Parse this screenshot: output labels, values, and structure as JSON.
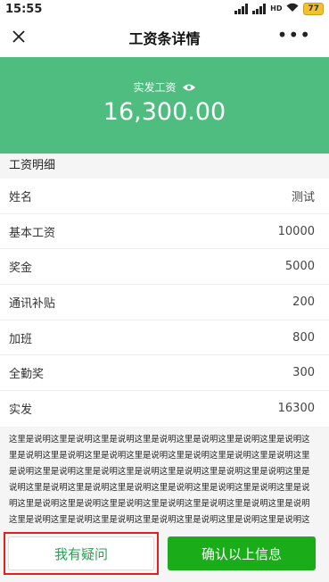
{
  "status_bar": {
    "time": "15:55",
    "network": "HD",
    "battery": "77"
  },
  "titlebar": {
    "title": "工资条详情",
    "more": "•••"
  },
  "banner": {
    "label": "实发工资",
    "amount": "16,300.00"
  },
  "section": {
    "title": "工资明细"
  },
  "rows": [
    {
      "label": "姓名",
      "value": "测试"
    },
    {
      "label": "基本工资",
      "value": "10000"
    },
    {
      "label": "奖金",
      "value": "5000"
    },
    {
      "label": "通讯补贴",
      "value": "200"
    },
    {
      "label": "加班",
      "value": "800"
    },
    {
      "label": "全勤奖",
      "value": "300"
    },
    {
      "label": "实发",
      "value": "16300"
    }
  ],
  "note": "这里是说明这里是说明这里是说明这里是说明这里是说明这里是说明这里是说明这里是说明这里是说明这里是说明这里是说明这里是说明这里是说明这里是说明这里是说明这里是说明这里是说明这里是说明这里是说明这里是说明这里是说明这里是说明这里是说明这里是说明这里是说明这里是说明这里是说明这里是说明这里是说明这里是说明这里是说明这里是说明这里是说明这里是说明这里是说明这里是说明这里是说明这里是说明这里是说明这里是说明这里是说明这里是说明这里是说明这里是说明这里是说明这里是说明",
  "buttons": {
    "question": "我有疑问",
    "confirm": "确认以上信息"
  },
  "colors": {
    "banner": "#4fbd7f",
    "confirm": "#1aad19",
    "highlight": "#e02020"
  }
}
